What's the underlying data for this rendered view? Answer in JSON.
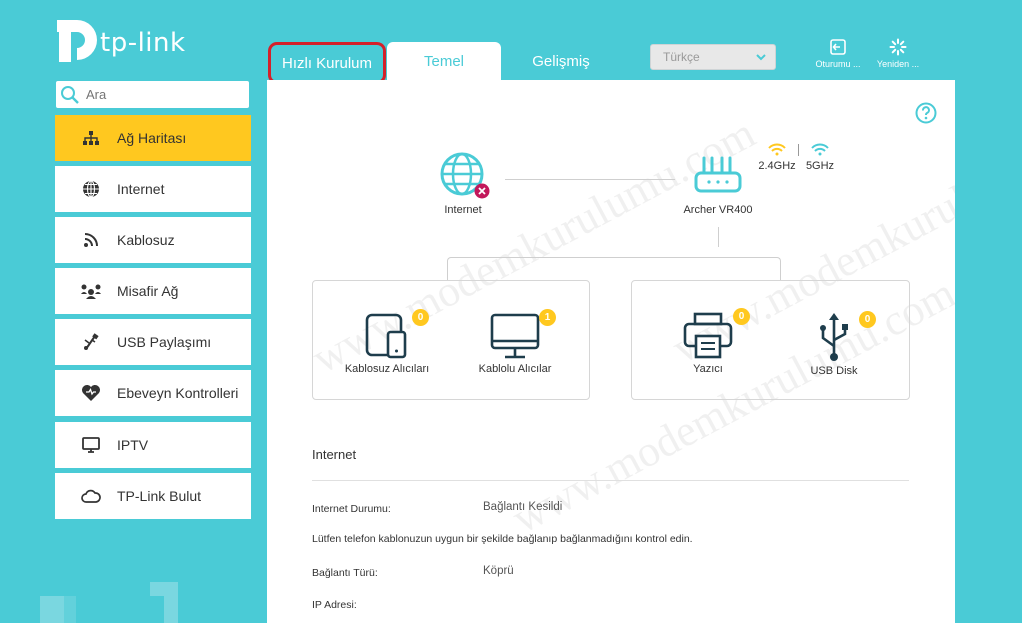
{
  "brand": {
    "logo_text": "tp-link"
  },
  "tabs": [
    {
      "label": "Hızlı Kurulum"
    },
    {
      "label": "Temel"
    },
    {
      "label": "Gelişmiş"
    }
  ],
  "language": {
    "selected": "Türkçe"
  },
  "top_actions": [
    {
      "label": "Oturumu ...",
      "icon": "logout-icon"
    },
    {
      "label": "Yeniden ...",
      "icon": "reboot-icon"
    }
  ],
  "search": {
    "placeholder": "Ara"
  },
  "sidebar": {
    "items": [
      {
        "label": "Ağ Haritası",
        "icon": "network-map-icon",
        "active": true
      },
      {
        "label": "Internet",
        "icon": "globe-icon"
      },
      {
        "label": "Kablosuz",
        "icon": "wireless-icon"
      },
      {
        "label": "Misafir Ağ",
        "icon": "guest-network-icon"
      },
      {
        "label": "USB Paylaşımı",
        "icon": "usb-share-icon"
      },
      {
        "label": "Ebeveyn Kontrolleri",
        "icon": "parental-heart-icon"
      },
      {
        "label": "IPTV",
        "icon": "tv-icon"
      },
      {
        "label": "TP-Link Bulut",
        "icon": "cloud-icon"
      }
    ]
  },
  "map": {
    "internet_label": "Internet",
    "router_label": "Archer VR400",
    "band_24": "2.4GHz",
    "band_5": "5GHz",
    "devices": [
      {
        "label": "Kablosuz Alıcıları",
        "count": "0",
        "icon": "tablet-icon"
      },
      {
        "label": "Kablolu Alıcılar",
        "count": "1",
        "icon": "monitor-icon"
      },
      {
        "label": "Yazıcı",
        "count": "0",
        "icon": "printer-icon"
      },
      {
        "label": "USB Disk",
        "count": "0",
        "icon": "usb-icon"
      }
    ]
  },
  "internet_section": {
    "title": "Internet",
    "status_label": "Internet Durumu:",
    "status_value": "Bağlantı Kesildi",
    "note": "Lütfen telefon kablonuzun uygun bir şekilde bağlanıp bağlanmadığını kontrol edin.",
    "conn_type_label": "Bağlantı Türü:",
    "conn_type_value": "Köprü",
    "ip_label": "IP Adresi:"
  },
  "watermark": {
    "text": "www.modemkurulumu.com"
  },
  "colors": {
    "accent": "#4acbd6",
    "active": "#ffc81f",
    "error": "#c2185b",
    "highlight": "#d4202a"
  }
}
